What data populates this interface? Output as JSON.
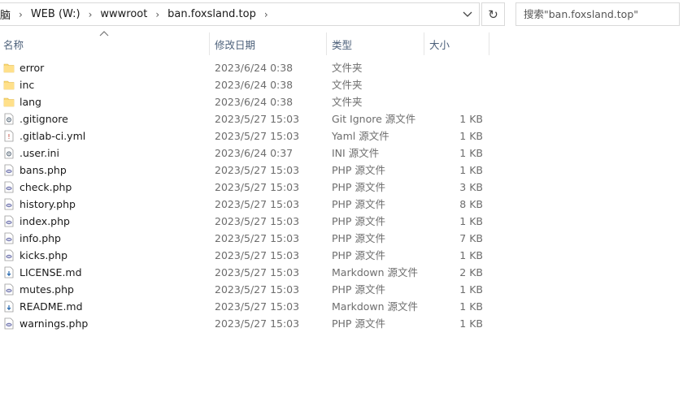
{
  "address_bar": {
    "crumbs": [
      "脑",
      "WEB (W:)",
      "wwwroot",
      "ban.foxsland.top"
    ]
  },
  "search": {
    "placeholder": "搜索\"ban.foxsland.top\""
  },
  "columns": {
    "name": "名称",
    "date": "修改日期",
    "type": "类型",
    "size": "大小"
  },
  "files": [
    {
      "name": "error",
      "date": "2023/6/24 0:38",
      "type": "文件夹",
      "size": "",
      "icon": "folder-icon"
    },
    {
      "name": "inc",
      "date": "2023/6/24 0:38",
      "type": "文件夹",
      "size": "",
      "icon": "folder-icon"
    },
    {
      "name": "lang",
      "date": "2023/6/24 0:38",
      "type": "文件夹",
      "size": "",
      "icon": "folder-icon"
    },
    {
      "name": ".gitignore",
      "date": "2023/5/27 15:03",
      "type": "Git Ignore 源文件",
      "size": "1 KB",
      "icon": "config-file-icon"
    },
    {
      "name": ".gitlab-ci.yml",
      "date": "2023/5/27 15:03",
      "type": "Yaml 源文件",
      "size": "1 KB",
      "icon": "yaml-file-icon"
    },
    {
      "name": ".user.ini",
      "date": "2023/6/24 0:37",
      "type": "INI 源文件",
      "size": "1 KB",
      "icon": "config-file-icon"
    },
    {
      "name": "bans.php",
      "date": "2023/5/27 15:03",
      "type": "PHP 源文件",
      "size": "1 KB",
      "icon": "php-file-icon"
    },
    {
      "name": "check.php",
      "date": "2023/5/27 15:03",
      "type": "PHP 源文件",
      "size": "3 KB",
      "icon": "php-file-icon"
    },
    {
      "name": "history.php",
      "date": "2023/5/27 15:03",
      "type": "PHP 源文件",
      "size": "8 KB",
      "icon": "php-file-icon"
    },
    {
      "name": "index.php",
      "date": "2023/5/27 15:03",
      "type": "PHP 源文件",
      "size": "1 KB",
      "icon": "php-file-icon"
    },
    {
      "name": "info.php",
      "date": "2023/5/27 15:03",
      "type": "PHP 源文件",
      "size": "7 KB",
      "icon": "php-file-icon"
    },
    {
      "name": "kicks.php",
      "date": "2023/5/27 15:03",
      "type": "PHP 源文件",
      "size": "1 KB",
      "icon": "php-file-icon"
    },
    {
      "name": "LICENSE.md",
      "date": "2023/5/27 15:03",
      "type": "Markdown 源文件",
      "size": "2 KB",
      "icon": "markdown-file-icon"
    },
    {
      "name": "mutes.php",
      "date": "2023/5/27 15:03",
      "type": "PHP 源文件",
      "size": "1 KB",
      "icon": "php-file-icon"
    },
    {
      "name": "README.md",
      "date": "2023/5/27 15:03",
      "type": "Markdown 源文件",
      "size": "1 KB",
      "icon": "markdown-file-icon"
    },
    {
      "name": "warnings.php",
      "date": "2023/5/27 15:03",
      "type": "PHP 源文件",
      "size": "1 KB",
      "icon": "php-file-icon"
    }
  ]
}
